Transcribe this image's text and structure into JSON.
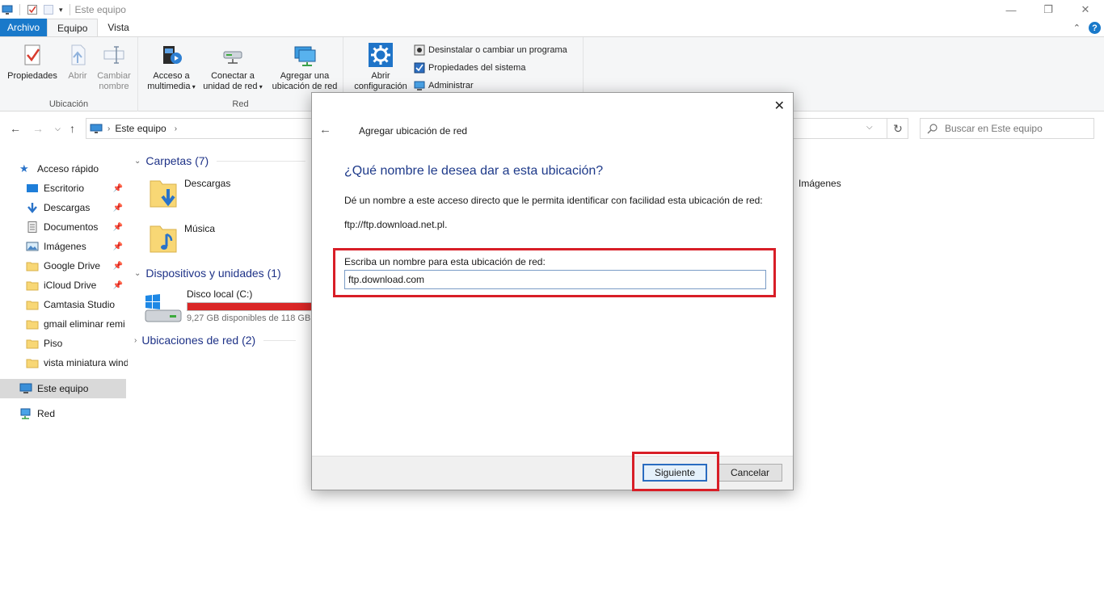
{
  "window": {
    "title": "Este equipo",
    "controls": [
      "minimize",
      "restore",
      "close"
    ]
  },
  "ribbon": {
    "tabs": [
      {
        "label": "Archivo",
        "active": false
      },
      {
        "label": "Equipo",
        "active": true
      },
      {
        "label": "Vista",
        "active": false
      }
    ],
    "groups": [
      {
        "label": "Ubicación",
        "buttons": [
          {
            "label": "Propiedades",
            "icon": "properties-icon",
            "enabled": true
          },
          {
            "label": "Abrir",
            "icon": "open-icon",
            "enabled": false
          },
          {
            "label": "Cambiar nombre",
            "icon": "rename-icon",
            "enabled": false
          }
        ]
      },
      {
        "label": "Red",
        "buttons": [
          {
            "label": "Acceso a multimedia",
            "icon": "media-access-icon",
            "enabled": true
          },
          {
            "label": "Conectar a unidad de red",
            "icon": "map-drive-icon",
            "enabled": true
          },
          {
            "label": "Agregar una ubicación de red",
            "icon": "add-network-location-icon",
            "enabled": true
          }
        ]
      },
      {
        "label": "Sistema",
        "buttons": [
          {
            "label": "Abrir configuración",
            "icon": "settings-gear-icon",
            "enabled": true
          }
        ],
        "small_buttons": [
          {
            "label": "Desinstalar o cambiar un programa",
            "icon": "uninstall-icon"
          },
          {
            "label": "Propiedades del sistema",
            "icon": "system-properties-icon"
          },
          {
            "label": "Administrar",
            "icon": "manage-icon"
          }
        ]
      }
    ]
  },
  "address": {
    "path": [
      "Este equipo"
    ],
    "search_placeholder": "Buscar en Este equipo"
  },
  "nav_pane": {
    "items": [
      {
        "label": "Acceso rápido",
        "icon": "star-icon",
        "pinned": false
      },
      {
        "label": "Escritorio",
        "icon": "desktop-icon",
        "pinned": true
      },
      {
        "label": "Descargas",
        "icon": "download-icon",
        "pinned": true
      },
      {
        "label": "Documentos",
        "icon": "documents-icon",
        "pinned": true
      },
      {
        "label": "Imágenes",
        "icon": "pictures-icon",
        "pinned": true
      },
      {
        "label": "Google Drive",
        "icon": "folder-icon",
        "pinned": true
      },
      {
        "label": "iCloud Drive",
        "icon": "folder-icon",
        "pinned": true
      },
      {
        "label": "Camtasia Studio",
        "icon": "folder-icon",
        "pinned": false
      },
      {
        "label": "gmail eliminar remi",
        "icon": "folder-icon",
        "pinned": false
      },
      {
        "label": "Piso",
        "icon": "folder-icon",
        "pinned": false
      },
      {
        "label": "vista miniatura wind",
        "icon": "folder-icon",
        "pinned": false
      },
      {
        "label": "Este equipo",
        "icon": "computer-icon",
        "selected": true
      },
      {
        "label": "Red",
        "icon": "network-icon",
        "selected": false
      }
    ]
  },
  "content": {
    "sections": [
      {
        "label": "Carpetas (7)"
      },
      {
        "label": "Dispositivos y unidades (1)"
      },
      {
        "label": "Ubicaciones de red (2)"
      }
    ],
    "folders": [
      {
        "name": "Descargas",
        "icon": "downloads-folder-icon"
      },
      {
        "name": "Música",
        "icon": "music-folder-icon"
      },
      {
        "name": "Imágenes",
        "icon": "pictures-folder-icon"
      }
    ],
    "drive": {
      "name": "Disco local (C:)",
      "free_text": "9,27 GB disponibles de 118 GB",
      "fill_color": "#da2626"
    }
  },
  "dialog": {
    "title": "Agregar ubicación de red",
    "heading": "¿Qué nombre le desea dar a esta ubicación?",
    "description": "Dé un nombre a este acceso directo que le permita identificar con facilidad esta ubicación de red:",
    "url": "ftp://ftp.download.net.pl.",
    "field_label": "Escriba un nombre para esta ubicación de red:",
    "field_value": "ftp.download.com",
    "next_button": "Siguiente",
    "cancel_button": "Cancelar",
    "highlight_color": "#d81e27"
  }
}
